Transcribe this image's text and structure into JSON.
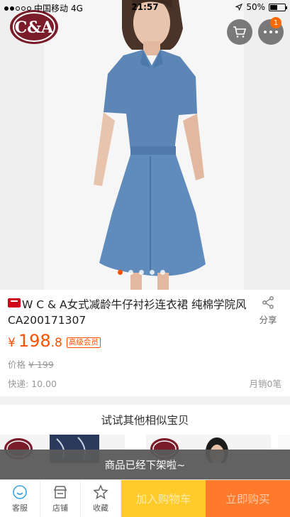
{
  "status_bar": {
    "carrier": "中国移动",
    "network": "4G",
    "time": "21:57",
    "battery": "50%",
    "battery_level": 0.5
  },
  "header": {
    "logo_text": "C&A",
    "cart_icon": "cart-icon",
    "more_icon": "more-icon",
    "more_badge": "1"
  },
  "gallery": {
    "image_count": 5,
    "active_index": 0
  },
  "product": {
    "platform_badge": "天猫",
    "title": "W C & A女式减龄牛仔衬衫连衣裙 纯棉学院风CA200171307",
    "price_symbol": "¥",
    "price_int": "198",
    "price_dec": ".8",
    "member_tag": "高级会员",
    "original_price_label": "价格",
    "original_price": "¥ 199",
    "shipping": "快递: 10.00",
    "monthly_sales": "月销0笔",
    "share_label": "分享"
  },
  "similar": {
    "heading": "试试其他相似宝贝"
  },
  "notice": {
    "delisted_text": "商品已经下架啦~"
  },
  "bottom_bar": {
    "service_label": "客服",
    "store_label": "店铺",
    "favorite_label": "收藏",
    "add_to_cart_label": "加入购物车",
    "buy_now_label": "立即购买"
  },
  "colors": {
    "accent": "#ff5000",
    "add_to_cart": "#ffcb2b",
    "buy_now": "#ff7a2b",
    "tmall_red": "#d0021b"
  }
}
